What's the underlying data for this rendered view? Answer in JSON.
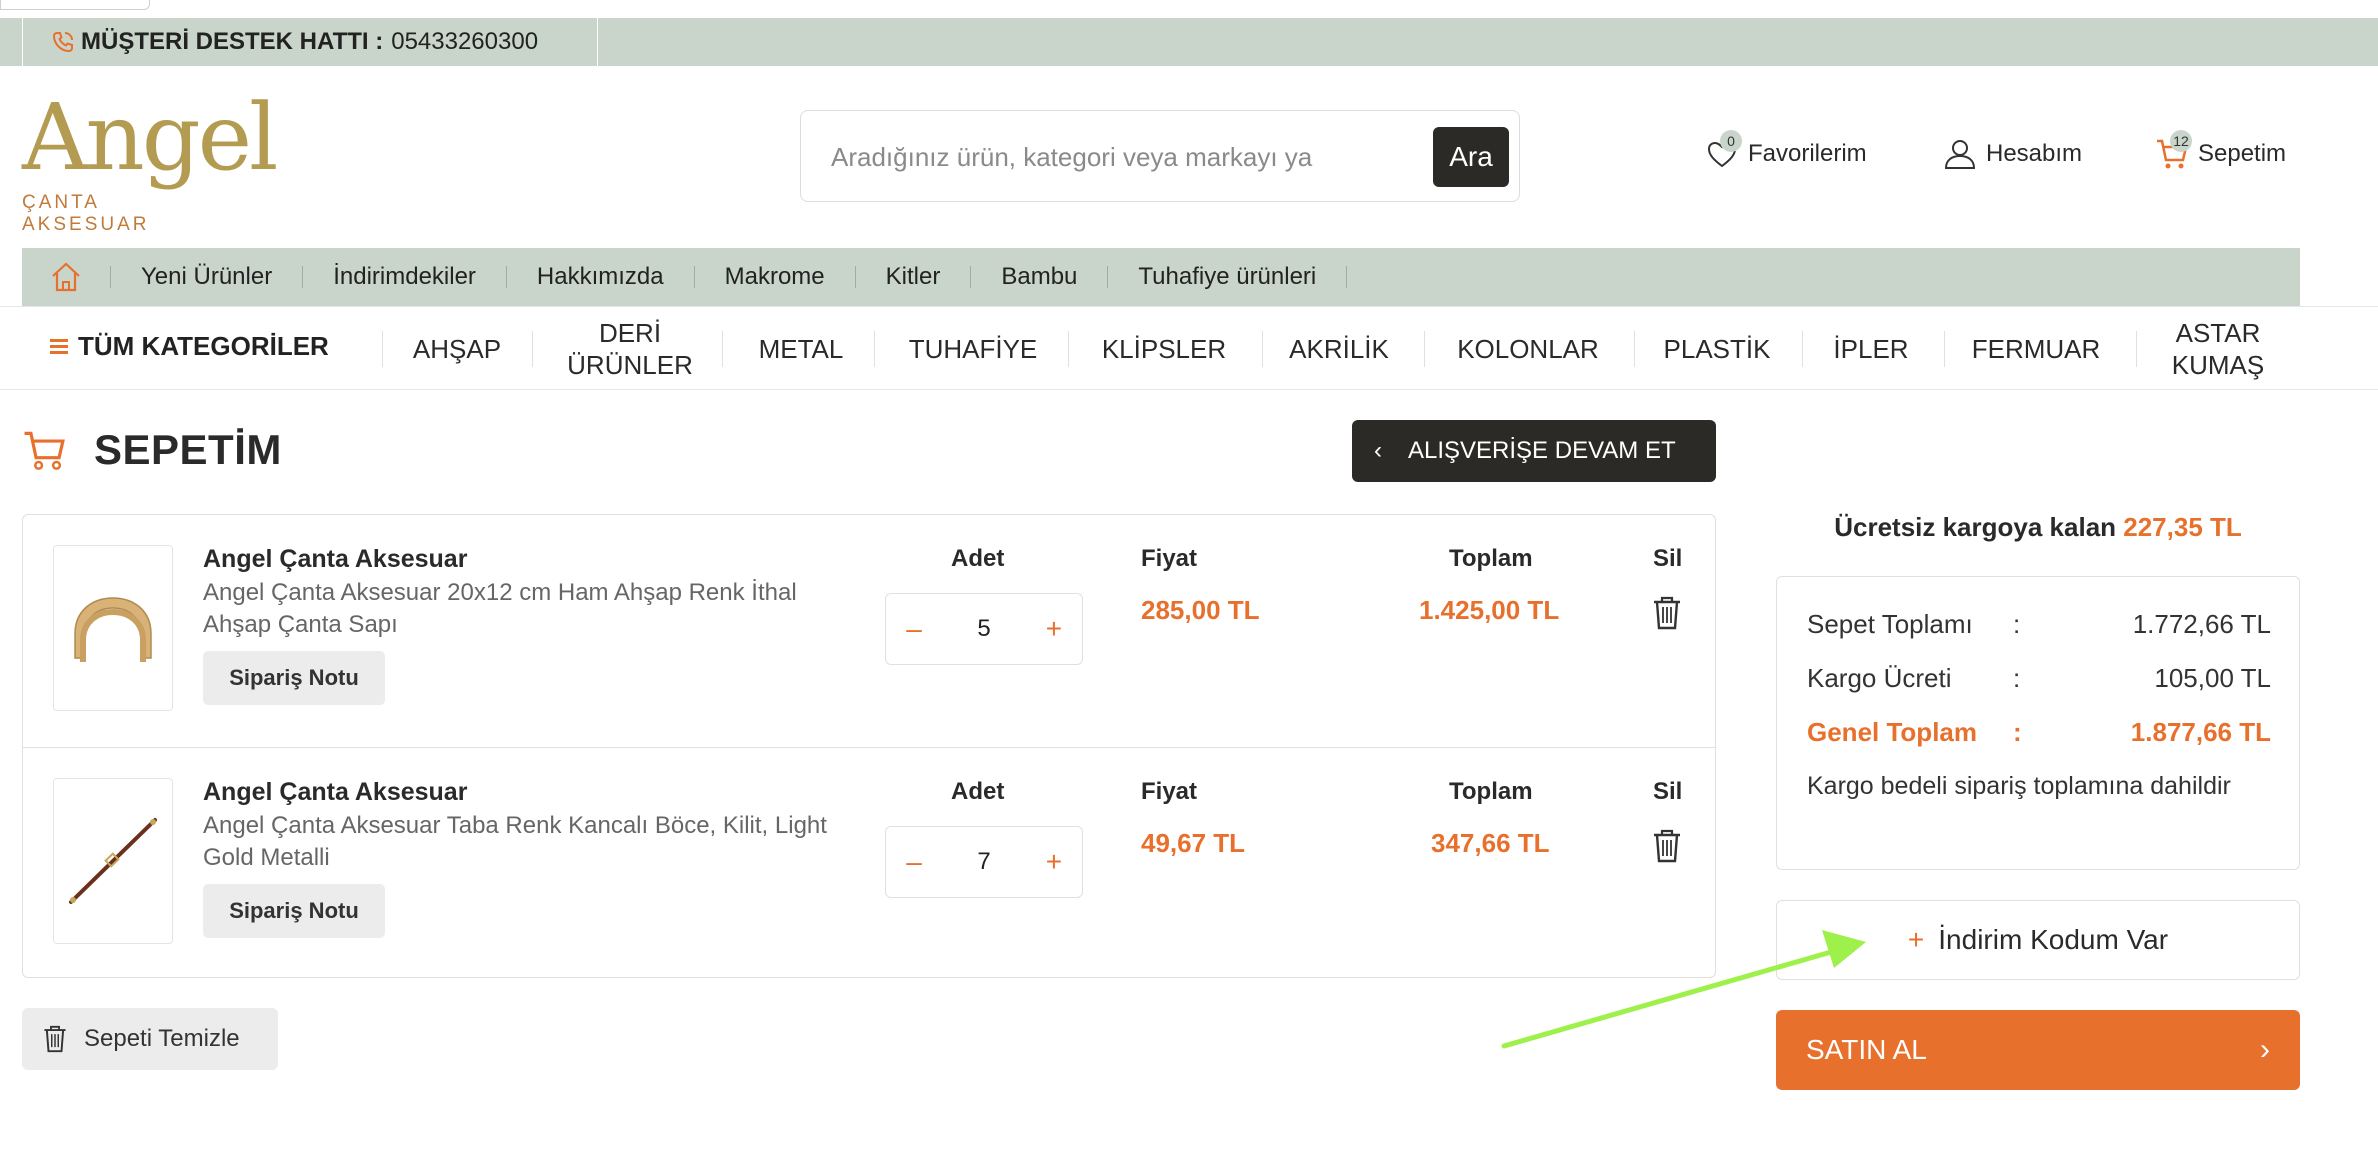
{
  "support": {
    "label": "MÜŞTERİ DESTEK HATTI :",
    "phone": "05433260300"
  },
  "logo": {
    "brand": "Angel",
    "tagline": "ÇANTA AKSESUAR"
  },
  "search": {
    "placeholder": "Aradığınız ürün, kategori veya markayı ya",
    "button": "Ara"
  },
  "header_links": {
    "favorites": {
      "label": "Favorilerim",
      "count": "0"
    },
    "account": {
      "label": "Hesabım"
    },
    "cart": {
      "label": "Sepetim",
      "count": "12"
    }
  },
  "main_nav": [
    "Yeni Ürünler",
    "İndirimdekiler",
    "Hakkımızda",
    "Makrome",
    "Kitler",
    "Bambu",
    "Tuhafiye ürünleri"
  ],
  "categories": {
    "all": "TÜM KATEGORİLER",
    "items": [
      "AHŞAP",
      "DERİ ÜRÜNLER",
      "METAL",
      "TUHAFİYE",
      "KLİPSLER",
      "AKRİLİK",
      "KOLONLAR",
      "PLASTİK",
      "İPLER",
      "FERMUAR",
      "ASTAR KUMAŞ"
    ]
  },
  "cart": {
    "title": "SEPETİM",
    "continue_button": "ALIŞVERİŞE DEVAM ET",
    "col_qty": "Adet",
    "col_price": "Fiyat",
    "col_total": "Toplam",
    "col_delete": "Sil",
    "note_button": "Sipariş Notu",
    "items": [
      {
        "brand": "Angel Çanta Aksesuar",
        "name": "Angel Çanta Aksesuar 20x12 cm Ham Ahşap Renk İthal Ahşap Çanta Sapı",
        "qty": "5",
        "price": "285,00 TL",
        "total": "1.425,00 TL"
      },
      {
        "brand": "Angel Çanta Aksesuar",
        "name": "Angel Çanta Aksesuar Taba Renk Kancalı Böce, Kilit, Light Gold Metalli",
        "qty": "7",
        "price": "49,67 TL",
        "total": "347,66 TL"
      }
    ],
    "clear_button": "Sepeti Temizle"
  },
  "summary": {
    "free_shipping_label": "Ücretsiz kargoya kalan",
    "free_shipping_amount": "227,35 TL",
    "subtotal_label": "Sepet Toplamı",
    "subtotal": "1.772,66 TL",
    "shipping_label": "Kargo Ücreti",
    "shipping": "105,00 TL",
    "grand_total_label": "Genel Toplam",
    "grand_total": "1.877,66 TL",
    "colon": ":",
    "note": "Kargo bedeli sipariş toplamına dahildir",
    "discount_label": "İndirim Kodum Var",
    "buy_button": "SATIN AL"
  },
  "colors": {
    "accent": "#e8702d",
    "nav_green": "#c9d5cb",
    "dark_button": "#2b2a27",
    "logo_gold": "#b39c52",
    "annotation_arrow": "#9ef04a"
  }
}
